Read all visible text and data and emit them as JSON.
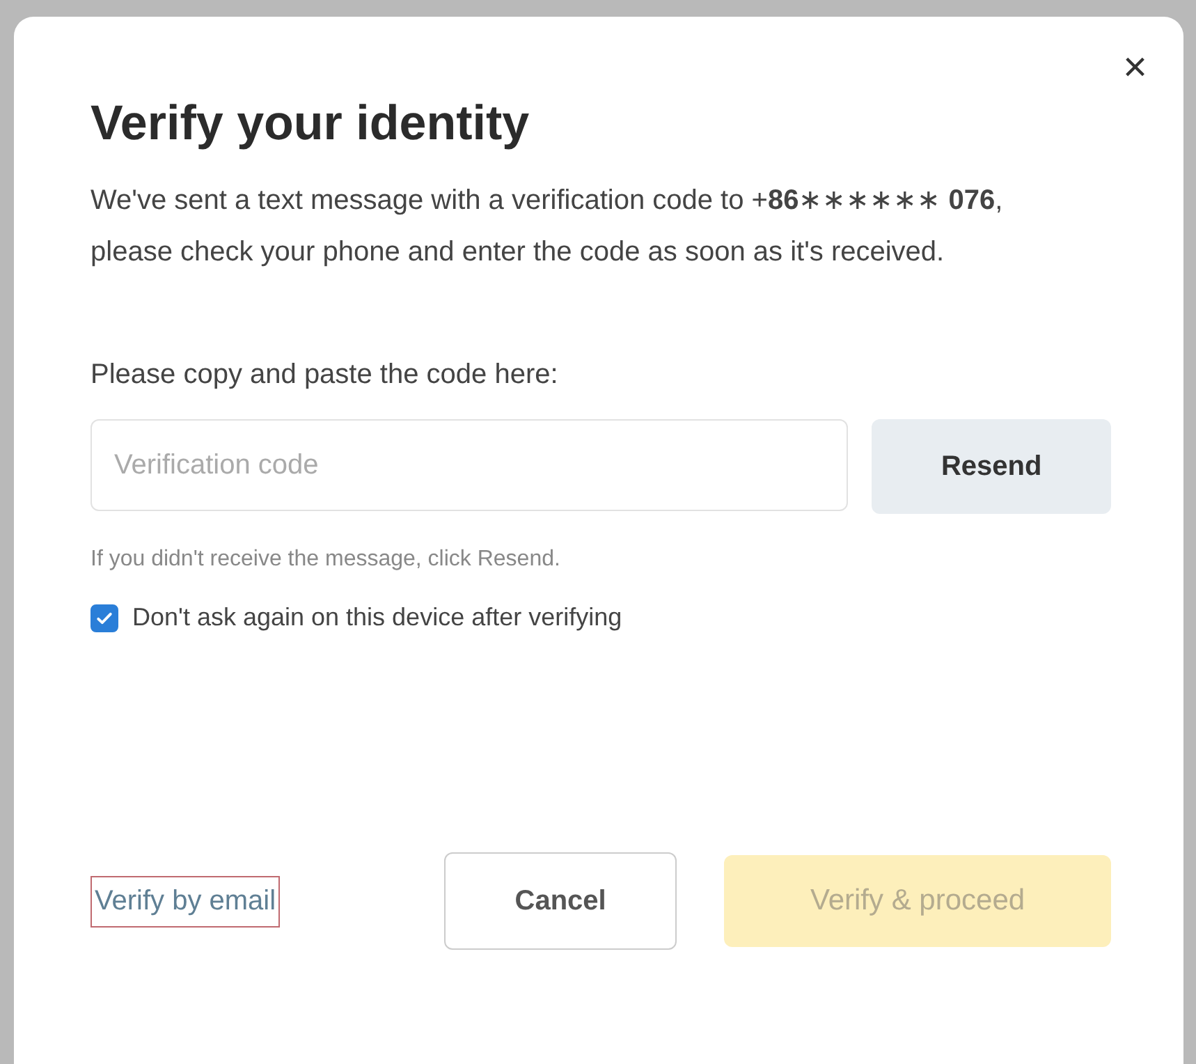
{
  "dialog": {
    "title": "Verify your identity",
    "close": "×",
    "message": "We've sent a text message with a verification code to +**86**∗∗∗∗∗∗ **076**, please check your phone and enter the code as soon as it's received.",
    "field_label": "Please copy and paste the code here:",
    "code_field": {
      "placeholder": "Verification code"
    },
    "resend_button": "Resend",
    "hint": "If you didn't receive the message, click Resend.",
    "remember": {
      "label": "Don't ask again on this device after verifying",
      "checked": true
    },
    "email_link": {
      "label": "Verify by email",
      "focused": true
    },
    "cancel_button": "Cancel",
    "proceed_button": {
      "label": "Verify & proceed",
      "disabled": true
    }
  }
}
